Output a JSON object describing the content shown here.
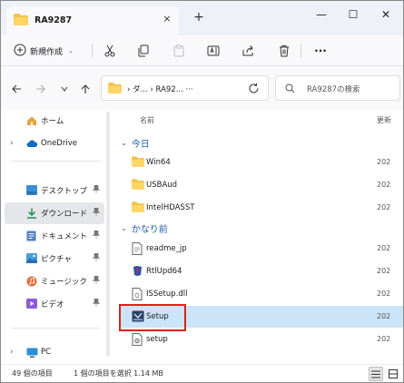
{
  "window": {
    "tab_title": "RA9287",
    "close_tab": "×",
    "new_tab": "+",
    "minimize": "—",
    "maximize": "☐",
    "close": "✕"
  },
  "toolbar": {
    "new_label": "新規作成",
    "new_caret": "⌄",
    "more": "···"
  },
  "address": {
    "path": "›  ダ...  ›  RA92...  ···",
    "search_placeholder": "RA9287の検索"
  },
  "sidebar": {
    "items": [
      {
        "label": "ホーム",
        "pinned": false
      },
      {
        "label": "OneDrive",
        "pinned": false
      },
      {
        "label": "デスクトップ",
        "pinned": true
      },
      {
        "label": "ダウンロード",
        "pinned": true
      },
      {
        "label": "ドキュメント",
        "pinned": true
      },
      {
        "label": "ピクチャ",
        "pinned": true
      },
      {
        "label": "ミュージック",
        "pinned": true
      },
      {
        "label": "ビデオ",
        "pinned": true
      },
      {
        "label": "PC",
        "pinned": false
      }
    ],
    "pin_glyph": "📌"
  },
  "content": {
    "column_name": "名前",
    "column_date": "更新",
    "groups": [
      {
        "label": "今日"
      },
      {
        "label": "かなり前"
      }
    ],
    "files": [
      {
        "name": "Win64",
        "date": "202"
      },
      {
        "name": "USBAud",
        "date": "202"
      },
      {
        "name": "IntelHDASST",
        "date": "202"
      },
      {
        "name": "readme_jp",
        "date": "202"
      },
      {
        "name": "RtlUpd64",
        "date": "202"
      },
      {
        "name": "ISSetup.dll",
        "date": "202"
      },
      {
        "name": "Setup",
        "date": "202"
      },
      {
        "name": "setup",
        "date": "202"
      }
    ]
  },
  "status": {
    "item_count": "49 個の項目",
    "selection": "1 個の項目を選択  1.14 MB"
  },
  "colors": {
    "accent": "#1f5fa8",
    "selection": "#cce4f7",
    "highlight": "#e0201b",
    "folder": "#f2c14e"
  }
}
